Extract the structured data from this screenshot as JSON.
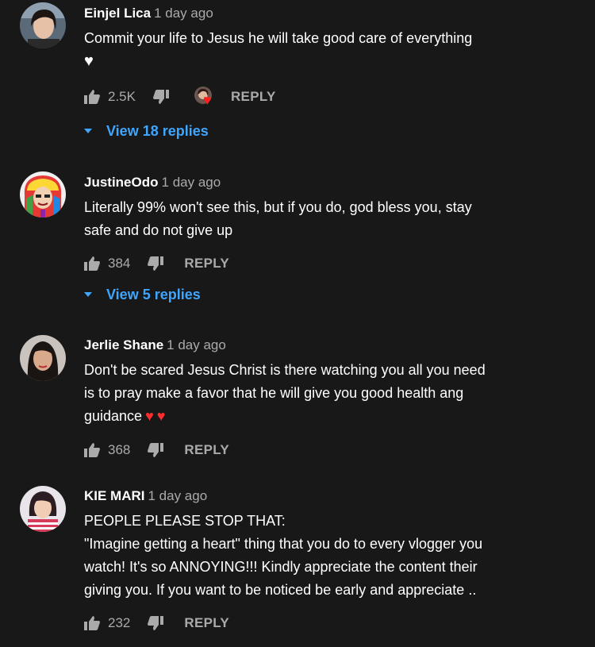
{
  "comments": [
    {
      "author": "Einjel Lica",
      "time": "1 day ago",
      "text": "Commit your life to Jesus he will take good care of everything",
      "likes": "2.5K",
      "reply_label": "REPLY",
      "view_replies": "View 18 replies",
      "creator_hearted": true
    },
    {
      "author": "JustineOdo",
      "time": "1 day ago",
      "text": "Literally 99% won't see this, but if you do, god bless you, stay\nsafe and do not give up",
      "likes": "384",
      "reply_label": "REPLY",
      "view_replies": "View 5 replies"
    },
    {
      "author": "Jerlie Shane",
      "time": "1 day ago",
      "text": "Don't be scared Jesus Christ is there watching you all you need\nis to pray make a favor that he will give you good health ang\nguidance",
      "likes": "368",
      "reply_label": "REPLY"
    },
    {
      "author": "KIE MARI",
      "time": "1 day ago",
      "text": "PEOPLE PLEASE STOP THAT:\n\"Imagine getting a heart\" thing that you do to every vlogger you\nwatch! It's so ANNOYING!!!  Kindly appreciate the content their\ngiving you. If you want to be noticed be early and appreciate ..",
      "likes": "232",
      "reply_label": "REPLY"
    }
  ],
  "colors": {
    "background": "#181818",
    "secondary_text": "#aaaaaa",
    "link_blue": "#3ea6ff",
    "heart_red": "#ff1f1f"
  },
  "icons": [
    "thumbs-up-icon",
    "thumbs-down-icon",
    "creator-heart-icon",
    "caret-down-icon"
  ]
}
